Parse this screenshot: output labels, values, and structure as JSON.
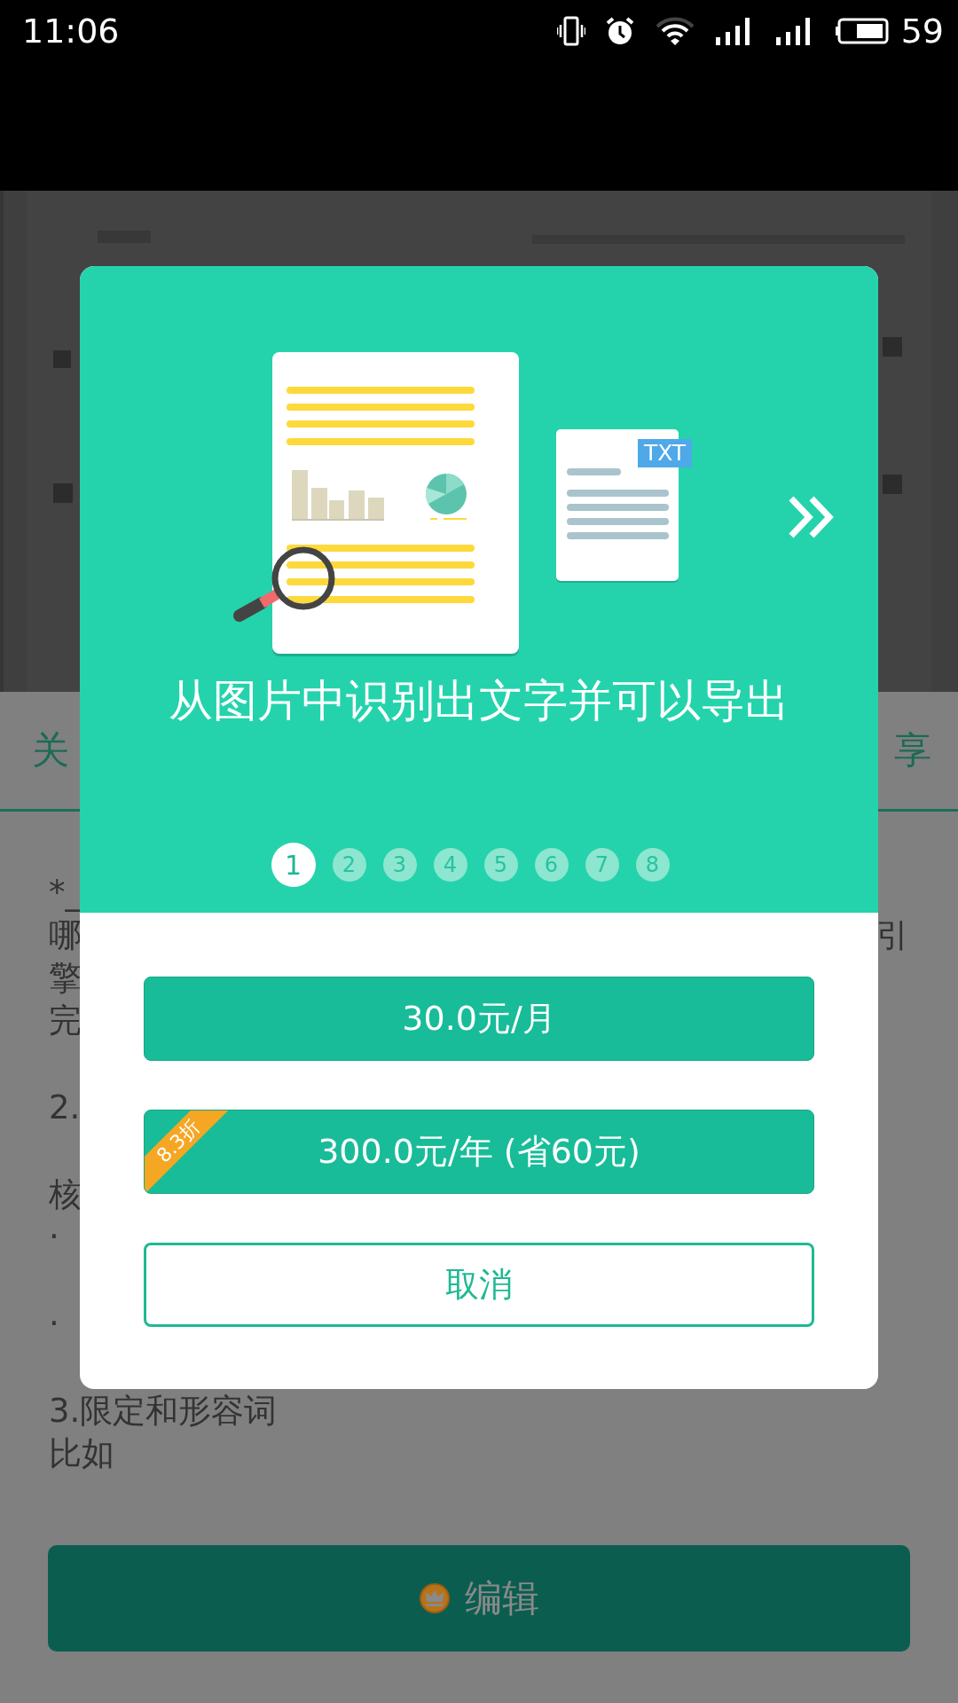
{
  "status_bar": {
    "time": "11:06",
    "battery": "59"
  },
  "background": {
    "tabs": [
      {
        "label": "关"
      },
      {
        "label": "享"
      }
    ],
    "paragraphs": [
      [
        "*_",
        "哪",
        "擎",
        "完"
      ],
      [
        "2."
      ],
      [
        "核",
        "·"
      ],
      [
        "·"
      ],
      [
        "3.限定和形容词",
        "比如"
      ]
    ],
    "right_lines": [
      "引"
    ],
    "edit_button": {
      "label": "编辑"
    }
  },
  "dialog": {
    "caption": "从图片中识别出文字并可以导出",
    "file_badge": "TXT",
    "pages": [
      {
        "label": "1",
        "selected": true
      },
      {
        "label": "2",
        "selected": false
      },
      {
        "label": "3",
        "selected": false
      },
      {
        "label": "4",
        "selected": false
      },
      {
        "label": "5",
        "selected": false
      },
      {
        "label": "6",
        "selected": false
      },
      {
        "label": "7",
        "selected": false
      },
      {
        "label": "8",
        "selected": false
      }
    ],
    "plans": [
      {
        "label": "30.0元/月"
      },
      {
        "label": "300.0元/年 (省60元)",
        "ribbon": "8.3折"
      }
    ],
    "cancel": "取消"
  }
}
